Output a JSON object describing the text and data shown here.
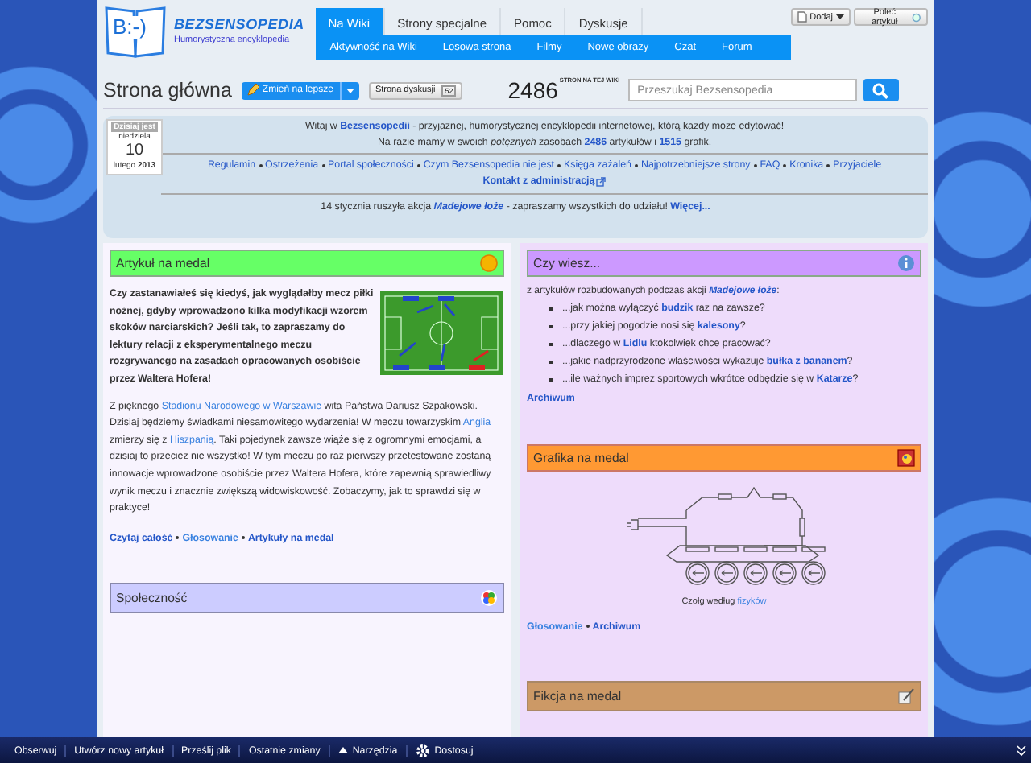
{
  "logo": {
    "mark": "B:-)",
    "name": "BEZSENSOPEDIA",
    "tagline": "Humorystyczna encyklopedia"
  },
  "tabs": [
    {
      "label": "Na Wiki",
      "selected": true
    },
    {
      "label": "Strony specjalne",
      "selected": false
    },
    {
      "label": "Pomoc",
      "selected": false
    },
    {
      "label": "Dyskusje",
      "selected": false
    }
  ],
  "subnav": [
    "Aktywność na Wiki",
    "Losowa strona",
    "Filmy",
    "Nowe obrazy",
    "Czat",
    "Forum"
  ],
  "top_buttons": {
    "add": "Dodaj",
    "recommend": "Poleć artykuł"
  },
  "page": {
    "title": "Strona główna",
    "edit_button": "Zmień na lepsze",
    "talk_button": "Strona dyskusji",
    "talk_count": "52",
    "page_count": "2486",
    "page_count_label": "STRON NA TEJ WIKI",
    "search": {
      "placeholder": "Przeszukaj Bezsensopedia"
    }
  },
  "calendar": {
    "header": "Dzisiaj jest",
    "weekday": "niedziela",
    "day": "10",
    "month_year": "lutego **2013**"
  },
  "welcome": [
    [
      {
        "t": "Witaj w "
      },
      {
        "t": "Bezsensopedii",
        "link": true,
        "bold": true
      },
      {
        "t": " - przyjaznej, humorystycznej encyklopedii internetowej, którą każdy może edytować!"
      }
    ],
    [
      {
        "t": "Na razie mamy w swoich *potężnych* zasobach "
      },
      {
        "t": "2486",
        "link": true,
        "bold": true
      },
      {
        "t": " artykułów i "
      },
      {
        "t": "1515",
        "link": true,
        "bold": true
      },
      {
        "t": " grafik."
      }
    ]
  ],
  "portal_links": [
    "Regulamin",
    "Ostrzeżenia",
    "Portal społeczności",
    "Czym Bezsensopedia nie jest",
    "Księga zażaleń",
    "Najpotrzebniejsze strony",
    "FAQ",
    "Kronika",
    "Przyjaciele"
  ],
  "contact_link": "Kontakt z administracją",
  "notice": [
    {
      "t": "14 stycznia ruszyła akcja "
    },
    {
      "t": "Madejowe łoże",
      "link": true,
      "bold": true,
      "italic": true
    },
    {
      "t": " - zapraszamy wszystkich do udziału! "
    },
    {
      "t": "Więcej...",
      "link": true,
      "bold": true
    }
  ],
  "featured_article": {
    "title": "Artykuł na medal",
    "color": "#66ff66",
    "lead": "Czy zastanawiałeś się kiedyś, jak wyglądałby mecz piłki nożnej, gdyby wprowadzono kilka modyfikacji wzorem skoków narciarskich? Jeśli tak, to zapraszamy do lektury relacji z eksperymentalnego meczu rozgrywanego na zasadach opracowanych osobiście przez Waltera Hofera!",
    "body": [
      {
        "t": "Z pięknego "
      },
      {
        "t": "Stadionu Narodowego w Warszawie",
        "link": true
      },
      {
        "t": " wita Państwa Dariusz Szpakowski. Dzisiaj będziemy świadkami niesamowitego wydarzenia! W meczu towarzyskim "
      },
      {
        "t": "Anglia",
        "link": true
      },
      {
        "t": " zmierzy się z "
      },
      {
        "t": "Hiszpanią",
        "link": true
      },
      {
        "t": ". Taki pojedynek zawsze wiąże się z ogromnymi emocjami, a dzisiaj to przecież nie wszystko! W tym meczu po raz pierwszy przetestowane zostaną innowacje wprowadzone osobiście przez Waltera Hofera, które zapewnią sprawiedliwy wynik meczu i znacznie zwiększą widowiskowość. Zobaczymy, jak to sprawdzi się w praktyce!"
      }
    ],
    "links": [
      "Czytaj całość",
      "Głosowanie",
      "Artykuły na medal"
    ]
  },
  "community": {
    "title": "Społeczność",
    "color": "#ccccff"
  },
  "did_you_know": {
    "title": "Czy wiesz...",
    "color": "#cc99ff",
    "intro": [
      {
        "t": "z artykułów rozbudowanych podczas akcji "
      },
      {
        "t": "Madejowe łoże",
        "link": true,
        "bold": true,
        "italic": true
      },
      {
        "t": ":"
      }
    ],
    "items": [
      [
        {
          "t": "...jak można wyłączyć "
        },
        {
          "t": "budzik",
          "link": true,
          "bold": true
        },
        {
          "t": " raz na zawsze?"
        }
      ],
      [
        {
          "t": "...przy jakiej pogodzie nosi się "
        },
        {
          "t": "kalesony",
          "link": true,
          "bold": true
        },
        {
          "t": "?"
        }
      ],
      [
        {
          "t": "...dlaczego w "
        },
        {
          "t": "Lidlu",
          "link": true,
          "bold": true
        },
        {
          "t": " ktokolwiek chce pracować?"
        }
      ],
      [
        {
          "t": "...jakie nadprzyrodzone właściwości wykazuje "
        },
        {
          "t": "bułka z bananem",
          "link": true,
          "bold": true
        },
        {
          "t": "?"
        }
      ],
      [
        {
          "t": "...ile ważnych imprez sportowych wkrótce odbędzie się w "
        },
        {
          "t": "Katarze",
          "link": true,
          "bold": true
        },
        {
          "t": "?"
        }
      ]
    ],
    "archive": "Archiwum"
  },
  "featured_image": {
    "title": "Grafika na medal",
    "color": "#ff9933",
    "caption": [
      {
        "t": "Czołg według "
      },
      {
        "t": "fizyków",
        "link": true
      }
    ],
    "links": [
      "Głosowanie",
      "Archiwum"
    ]
  },
  "featured_fiction": {
    "title": "Fikcja na medal",
    "color": "#cc9966"
  },
  "toolbar": [
    "Obserwuj",
    "Utwórz nowy artykuł",
    "Prześlij plik",
    "Ostatnie zmiany",
    "Narzędzia",
    "Dostosuj"
  ]
}
